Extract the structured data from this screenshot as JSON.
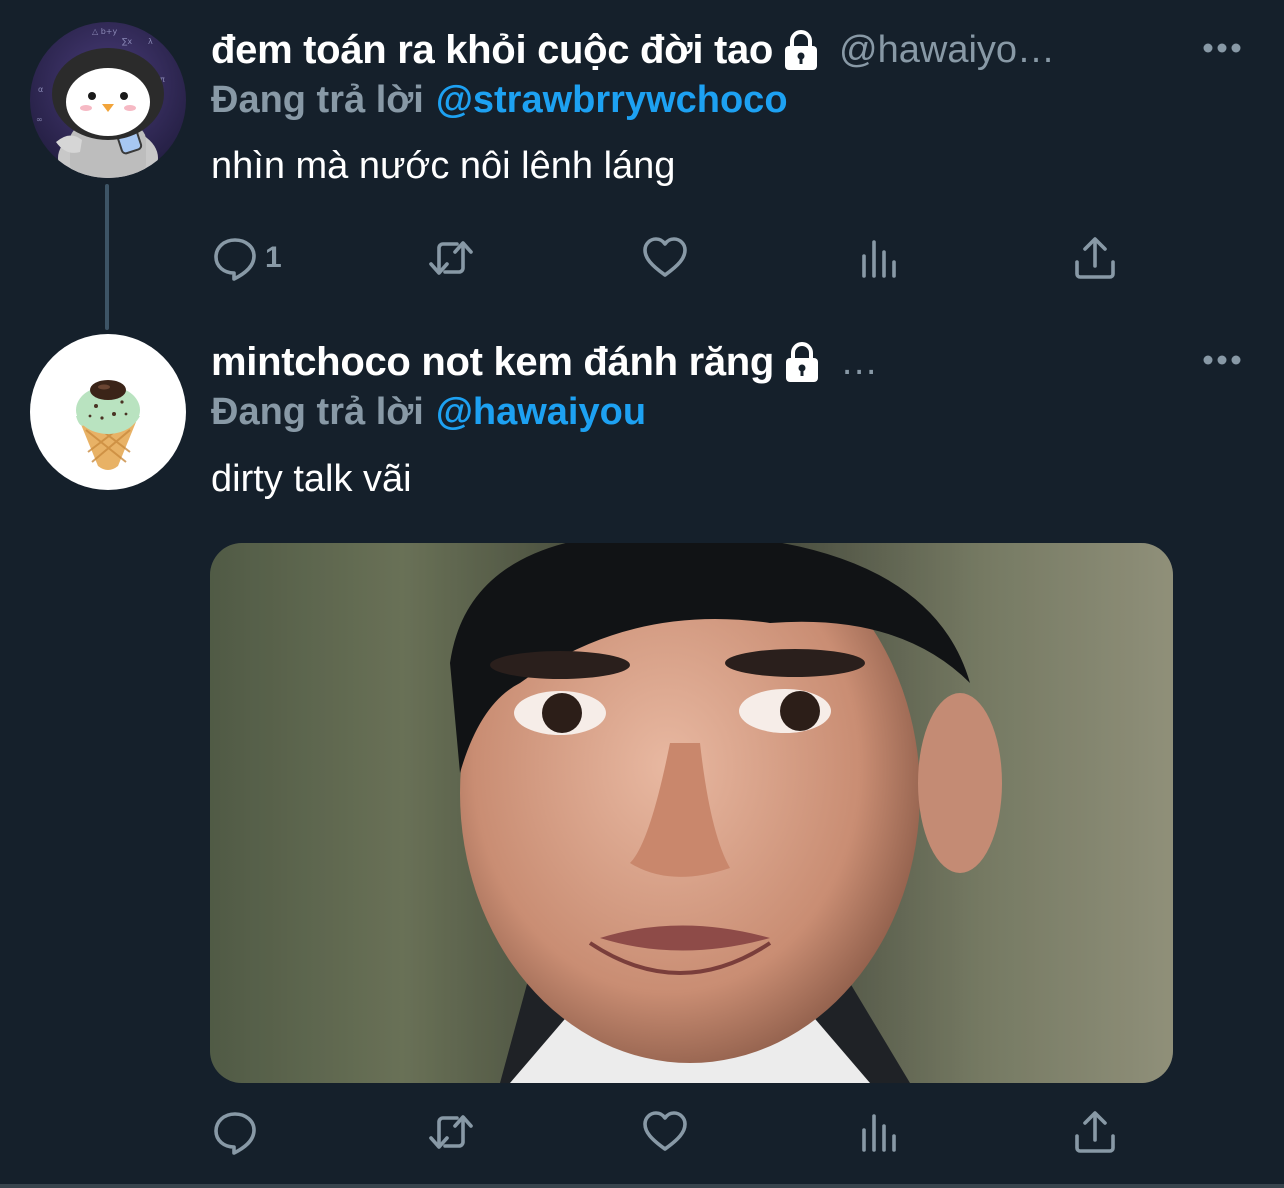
{
  "colors": {
    "background": "#15202b",
    "primary_text": "#ffffff",
    "secondary_text": "#8899a6",
    "accent": "#1da1f2"
  },
  "tweets": [
    {
      "display_name": "đem toán ra khỏi cuộc đời tao",
      "protected_icon": "lock-icon",
      "handle": "@hawaiyo…",
      "reply_prefix": "Đang trả lời",
      "reply_to": "@strawbrrywchoco",
      "text": "nhìn mà nước nôi lênh láng",
      "reply_count": "1",
      "avatar": "penguin-avatar"
    },
    {
      "display_name": "mintchoco not kem đánh răng",
      "protected_icon": "lock-icon",
      "handle": "…",
      "reply_prefix": "Đang trả lời",
      "reply_to": "@hawaiyou",
      "text": "dirty talk vãi",
      "reply_count": "",
      "avatar": "ice-cream-avatar",
      "media": "reaction-photo"
    }
  ]
}
